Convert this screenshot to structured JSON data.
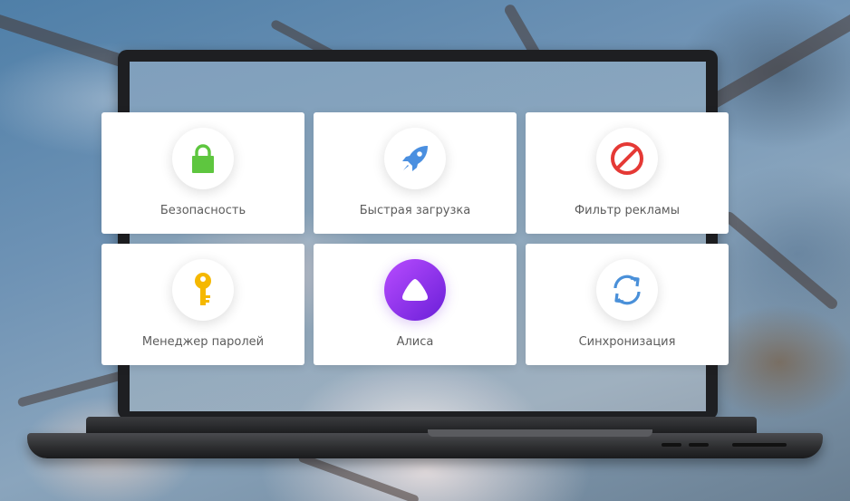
{
  "features": [
    {
      "label": "Безопасность",
      "icon": "lock-icon",
      "color": "#5ec63f"
    },
    {
      "label": "Быстрая загрузка",
      "icon": "rocket-icon",
      "color": "#4a8fe0"
    },
    {
      "label": "Фильтр рекламы",
      "icon": "no-entry-icon",
      "color": "#e53935"
    },
    {
      "label": "Менеджер паролей",
      "icon": "key-icon",
      "color": "#f5b800"
    },
    {
      "label": "Алиса",
      "icon": "alice-icon",
      "color": "#8a2be2"
    },
    {
      "label": "Синхронизация",
      "icon": "sync-icon",
      "color": "#4a90d9"
    }
  ]
}
